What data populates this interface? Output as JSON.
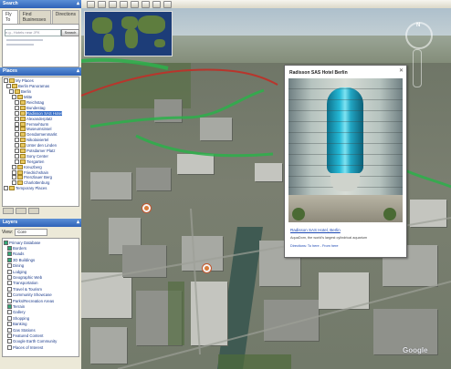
{
  "search": {
    "title": "Search",
    "tabs": [
      "Fly To",
      "Find Businesses",
      "Directions"
    ],
    "placeholder": "e.g., Hotels near JFK",
    "button": "Search"
  },
  "places": {
    "title": "Places",
    "items": [
      {
        "label": "My Places",
        "depth": 0
      },
      {
        "label": "Berlin Panoramas",
        "depth": 1
      },
      {
        "label": "Berlin",
        "depth": 2
      },
      {
        "label": "Mitte",
        "depth": 3
      },
      {
        "label": "Reichstag",
        "depth": 4
      },
      {
        "label": "Bundestag",
        "depth": 4
      },
      {
        "label": "Radisson SAS Hotel",
        "depth": 4,
        "selected": true
      },
      {
        "label": "Alexanderplatz",
        "depth": 4
      },
      {
        "label": "Fernsehturm",
        "depth": 4
      },
      {
        "label": "Museumsinsel",
        "depth": 4
      },
      {
        "label": "Gendarmenmarkt",
        "depth": 4
      },
      {
        "label": "Nikolaiviertel",
        "depth": 4
      },
      {
        "label": "Unter den Linden",
        "depth": 4
      },
      {
        "label": "Potsdamer Platz",
        "depth": 4
      },
      {
        "label": "Sony Center",
        "depth": 4
      },
      {
        "label": "Tiergarten",
        "depth": 4
      },
      {
        "label": "Kreuzberg",
        "depth": 3
      },
      {
        "label": "Friedrichshain",
        "depth": 3
      },
      {
        "label": "Prenzlauer Berg",
        "depth": 3
      },
      {
        "label": "Charlottenburg",
        "depth": 3
      },
      {
        "label": "Temporary Places",
        "depth": 0
      }
    ]
  },
  "layers": {
    "title": "Layers",
    "view_label": "View:",
    "view_value": "Core",
    "items": [
      {
        "label": "Primary Database",
        "on": true
      },
      {
        "label": "Borders",
        "on": true
      },
      {
        "label": "Roads",
        "on": true
      },
      {
        "label": "3D Buildings",
        "on": true
      },
      {
        "label": "Dining",
        "on": false
      },
      {
        "label": "Lodging",
        "on": false
      },
      {
        "label": "Geographic Web",
        "on": false
      },
      {
        "label": "Transportation",
        "on": false
      },
      {
        "label": "Travel & Tourism",
        "on": false
      },
      {
        "label": "Community Showcase",
        "on": false
      },
      {
        "label": "Parks/Recreation Areas",
        "on": false
      },
      {
        "label": "Terrain",
        "on": true
      },
      {
        "label": "Gallery",
        "on": false
      },
      {
        "label": "Shopping",
        "on": false
      },
      {
        "label": "Banking",
        "on": false
      },
      {
        "label": "Gas Stations",
        "on": false
      },
      {
        "label": "Featured Content",
        "on": false
      },
      {
        "label": "Google Earth Community",
        "on": false
      },
      {
        "label": "Places of Interest",
        "on": false
      }
    ]
  },
  "balloon": {
    "title": "Radisson SAS Hotel Berlin",
    "close": "✕",
    "link": "Radisson SAS Hotel, Berlin",
    "text": "AquaDom, the world's largest cylindrical aquarium",
    "directions": "Directions: To here - From here"
  },
  "map": {
    "compass_label": "N",
    "watermark": "Google"
  },
  "colors": {
    "accent": "#316ac5",
    "panel_header": "#3a6fc4",
    "road_red": "#b8352c",
    "route_green": "#2bb04a"
  }
}
